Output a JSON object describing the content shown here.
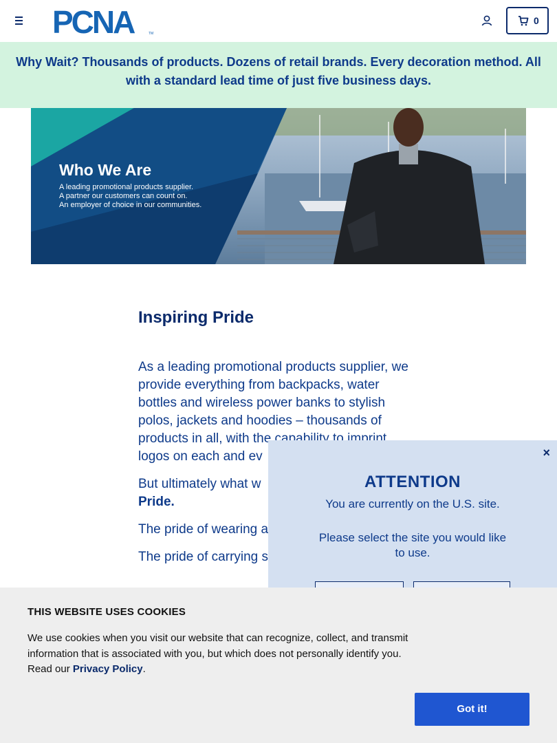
{
  "header": {
    "logo_text": "PCNA",
    "logo_tm": "TM",
    "cart_count": "0"
  },
  "promo": {
    "text": "Why Wait? Thousands of products. Dozens of retail brands. Every decoration method. All with a standard lead time of just five business days."
  },
  "hero": {
    "title": "Who We Are",
    "lines": [
      "A leading promotional products supplier.",
      "A partner our customers can count on.",
      "An employer of choice in our communities."
    ]
  },
  "content": {
    "heading": "Inspiring Pride",
    "para1": "As a leading promotional products supplier, we provide everything from backpacks, water bottles and wireless power banks to stylish polos, jackets and hoodies – thousands of products in all, with the capability to imprint logos on each and ev",
    "para2_text": "But ultimately what w",
    "para2_bold": "Pride.",
    "para3": "The pride of wearing apparel at a tradesho",
    "para4": "The pride of carrying school mascot aroun"
  },
  "modal": {
    "close": "×",
    "title": "ATTENTION",
    "line": "You are currently on the U.S. site.",
    "prompt": "Please select the site you would like to use."
  },
  "cookie": {
    "title": "THIS WEBSITE USES COOKIES",
    "text": "We use cookies when you visit our website that can recognize, collect, and transmit information that is associated with you, but which does not personally identify you. Read our ",
    "link": "Privacy Policy",
    "after": ".",
    "button": "Got it!"
  },
  "colors": {
    "navy": "#0b2a6b",
    "promo_bg": "#d3f3df",
    "modal_bg": "#d4e0f1",
    "cookie_bg": "#eeeeee",
    "button_blue": "#1f56d1"
  }
}
